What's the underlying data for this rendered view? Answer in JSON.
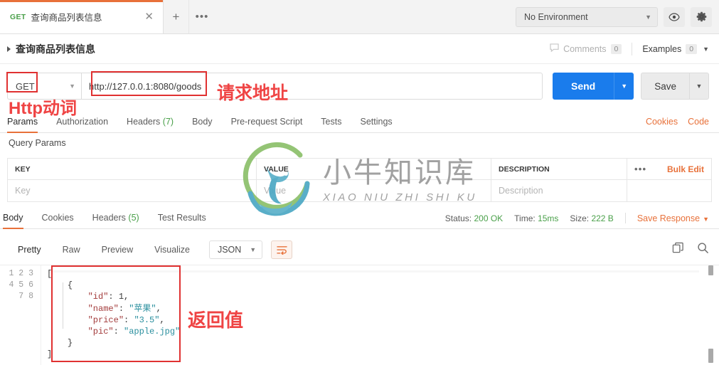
{
  "tabbar": {
    "request_tab": {
      "method": "GET",
      "name": "查询商品列表信息",
      "close_icon": "close-icon"
    },
    "new_tab_label": "+",
    "more_tabs_label": "•••",
    "environment": {
      "value": "No Environment",
      "caret": "▼"
    },
    "eye_icon": "eye-icon",
    "gear_icon": "gear-icon"
  },
  "request_header": {
    "name": "查询商品列表信息",
    "comments_label": "Comments",
    "comments_count": "0",
    "examples_label": "Examples",
    "examples_count": "0",
    "examples_caret": "▼"
  },
  "url_bar": {
    "method": "GET",
    "method_caret": "▼",
    "url": "http://127.0.0.1:8080/goods",
    "send_label": "Send",
    "send_caret": "▼",
    "save_label": "Save",
    "save_caret": "▼"
  },
  "request_tabs": {
    "items": [
      {
        "label": "Params",
        "count": "",
        "active": true
      },
      {
        "label": "Authorization",
        "count": "",
        "active": false
      },
      {
        "label": "Headers",
        "count": "(7)",
        "active": false
      },
      {
        "label": "Body",
        "count": "",
        "active": false
      },
      {
        "label": "Pre-request Script",
        "count": "",
        "active": false
      },
      {
        "label": "Tests",
        "count": "",
        "active": false
      },
      {
        "label": "Settings",
        "count": "",
        "active": false
      }
    ],
    "cookies_link": "Cookies",
    "code_link": "Code"
  },
  "query_params": {
    "section_label": "Query Params",
    "columns": [
      "KEY",
      "VALUE",
      "DESCRIPTION"
    ],
    "rows": [
      {
        "key": "Key",
        "value": "Value",
        "description": "Description"
      }
    ],
    "dots_label": "•••",
    "bulk_edit_label": "Bulk Edit"
  },
  "response_tabs": {
    "items": [
      {
        "label": "Body",
        "count": "",
        "active": true
      },
      {
        "label": "Cookies",
        "count": "",
        "active": false
      },
      {
        "label": "Headers",
        "count": "(5)",
        "active": false
      },
      {
        "label": "Test Results",
        "count": "",
        "active": false
      }
    ],
    "status_label": "Status:",
    "status_value": "200 OK",
    "time_label": "Time:",
    "time_value": "15ms",
    "size_label": "Size:",
    "size_value": "222 B",
    "save_response_label": "Save Response",
    "save_response_caret": "▼"
  },
  "response_toolbar": {
    "formats": [
      {
        "label": "Pretty",
        "active": true
      },
      {
        "label": "Raw",
        "active": false
      },
      {
        "label": "Preview",
        "active": false
      },
      {
        "label": "Visualize",
        "active": false
      }
    ],
    "type_select": "JSON",
    "type_caret": "▼",
    "wrap_icon": "wrap-lines-icon",
    "copy_icon": "copy-icon",
    "search_icon": "search-icon"
  },
  "response_body": {
    "line_numbers": "1\n2\n3\n4\n5\n6\n7\n8",
    "lines": [
      {
        "indent": 0,
        "parts": [
          {
            "t": "pun",
            "v": "["
          }
        ]
      },
      {
        "indent": 1,
        "parts": [
          {
            "t": "pun",
            "v": "{"
          }
        ]
      },
      {
        "indent": 2,
        "parts": [
          {
            "t": "key",
            "v": "\"id\""
          },
          {
            "t": "pun",
            "v": ": "
          },
          {
            "t": "num",
            "v": "1"
          },
          {
            "t": "pun",
            "v": ","
          }
        ]
      },
      {
        "indent": 2,
        "parts": [
          {
            "t": "key",
            "v": "\"name\""
          },
          {
            "t": "pun",
            "v": ": "
          },
          {
            "t": "str",
            "v": "\"苹果\""
          },
          {
            "t": "pun",
            "v": ","
          }
        ]
      },
      {
        "indent": 2,
        "parts": [
          {
            "t": "key",
            "v": "\"price\""
          },
          {
            "t": "pun",
            "v": ": "
          },
          {
            "t": "str",
            "v": "\"3.5\""
          },
          {
            "t": "pun",
            "v": ","
          }
        ]
      },
      {
        "indent": 2,
        "parts": [
          {
            "t": "key",
            "v": "\"pic\""
          },
          {
            "t": "pun",
            "v": ": "
          },
          {
            "t": "str",
            "v": "\"apple.jpg\""
          }
        ]
      },
      {
        "indent": 1,
        "parts": [
          {
            "t": "pun",
            "v": "}"
          }
        ]
      },
      {
        "indent": 0,
        "parts": [
          {
            "t": "pun",
            "v": "]"
          }
        ]
      }
    ]
  },
  "watermark": {
    "cn": "小牛知识库",
    "en": "XIAO NIU ZHI SHI KU"
  },
  "annotations": {
    "http_verb": "Http动词",
    "request_url": "请求地址",
    "return_value": "返回值",
    "color": "#ef4444"
  }
}
